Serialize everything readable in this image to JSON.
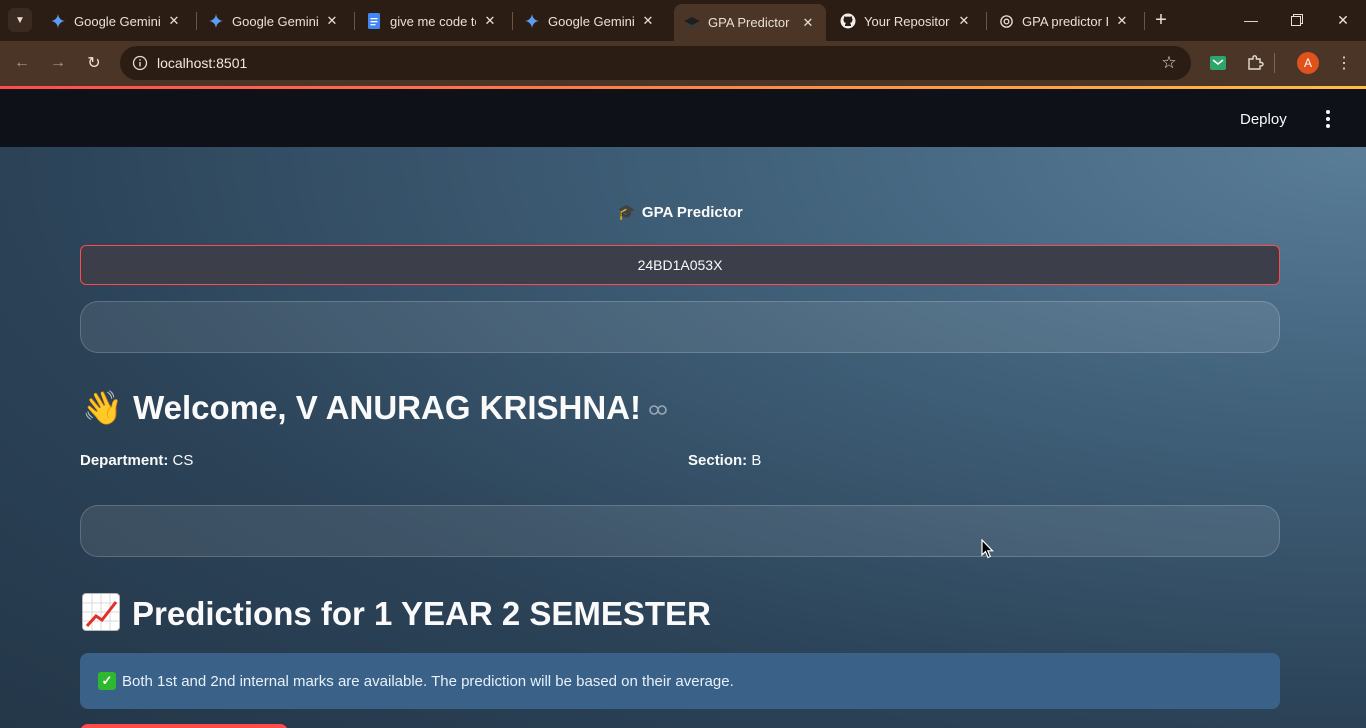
{
  "browser": {
    "tabs": [
      {
        "title": "Google Gemini",
        "favicon": "gemini-icon",
        "active": false
      },
      {
        "title": "Google Gemini",
        "favicon": "gemini-icon",
        "active": false
      },
      {
        "title": "give me code to",
        "favicon": "docs-icon",
        "active": false
      },
      {
        "title": "Google Gemini",
        "favicon": "gemini-icon",
        "active": false
      },
      {
        "title": "GPA Predictor",
        "favicon": "graduation-cap-icon",
        "active": true
      },
      {
        "title": "Your Repositorie",
        "favicon": "github-icon",
        "active": false
      },
      {
        "title": "GPA predictor RI",
        "favicon": "chatgpt-icon",
        "active": false
      }
    ],
    "url": "localhost:8501",
    "profile_initial": "A",
    "accent_colors": {
      "tabstrip": "#2b1d14",
      "toolbar": "#4a3526",
      "profile": "#e0521b"
    }
  },
  "app": {
    "deploy_label": "Deploy",
    "title_emoji": "🎓",
    "title": "GPA Predictor",
    "roll_number": "24BD1A053X",
    "welcome_emoji": "👋",
    "welcome_text": "Welcome, V ANURAG KRISHNA!",
    "department_label": "Department:",
    "department_value": "CS",
    "section_label": "Section:",
    "section_value": "B",
    "predictions_title": "Predictions for 1 YEAR 2 SEMESTER",
    "info_message": "Both 1st and 2nd internal marks are available. The prediction will be based on their average.",
    "accent_colors": {
      "primary": "#ff4b4b",
      "info_bg": "#3a6187",
      "header_bg": "#0e1117"
    }
  }
}
